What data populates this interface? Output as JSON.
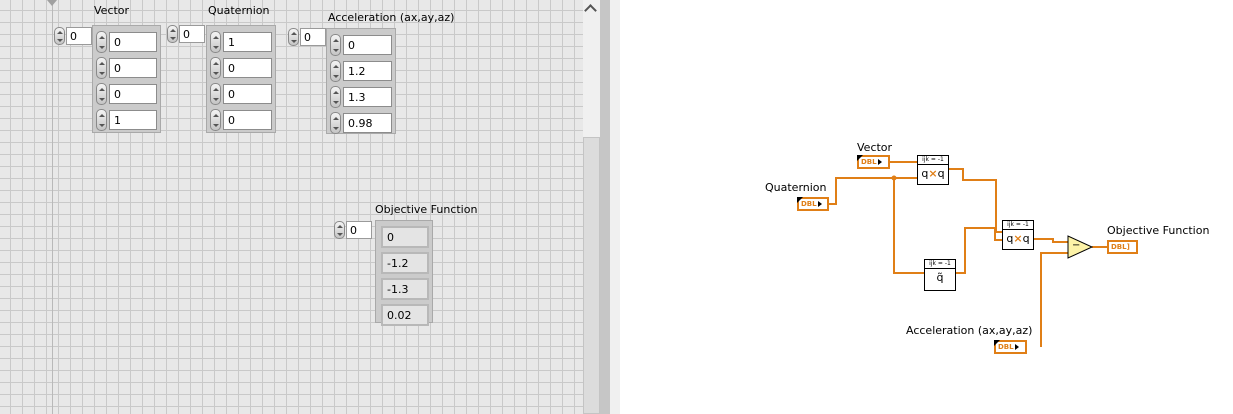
{
  "front_panel": {
    "vector": {
      "label": "Vector",
      "index": "0",
      "values": [
        "0",
        "0",
        "0",
        "1"
      ]
    },
    "quaternion": {
      "label": "Quaternion",
      "index": "0",
      "values": [
        "1",
        "0",
        "0",
        "0"
      ]
    },
    "acceleration": {
      "label": "Acceleration (ax,ay,az)",
      "index": "0",
      "values": [
        "0",
        "1.2",
        "1.3",
        "0.98"
      ]
    },
    "objective": {
      "label": "Objective Function",
      "index": "0",
      "values": [
        "0",
        "-1.2",
        "-1.3",
        "0.02"
      ]
    }
  },
  "block_diagram": {
    "vector_label": "Vector",
    "quaternion_label": "Quaternion",
    "acceleration_label": "Acceleration (ax,ay,az)",
    "objective_label": "Objective Function",
    "terminal_type": "DBL",
    "indicator_type": "DBL]",
    "node_header": "ijk = -1",
    "multiply_glyph_q1": "q",
    "multiply_glyph_x": "×",
    "multiply_glyph_q2": "q",
    "conjugate_glyph": "q̃",
    "subtract_glyph": "−",
    "wire_color": "#e07f17"
  }
}
